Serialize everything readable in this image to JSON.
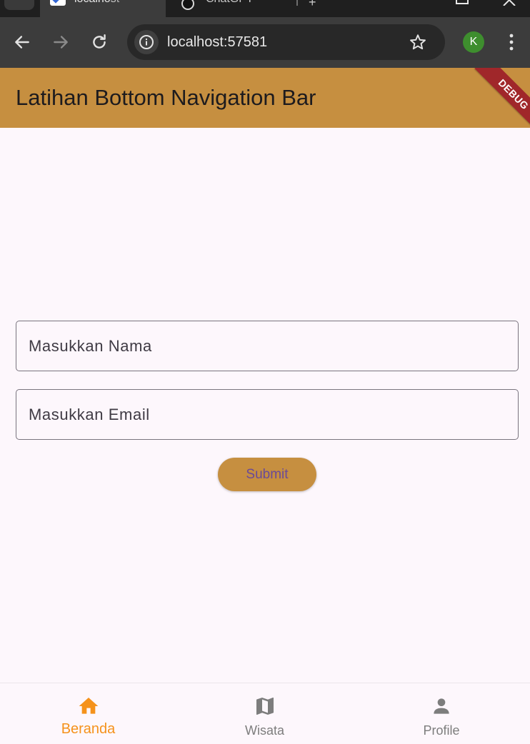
{
  "browser": {
    "tabs": [
      {
        "title": "localhost",
        "active": true
      },
      {
        "title": "ChatGPT",
        "active": false
      }
    ],
    "url": "localhost:57581",
    "profile_initial": "K"
  },
  "app": {
    "title": "Latihan Bottom Navigation Bar",
    "debug_banner": "DEBUG",
    "colors": {
      "primary": "#c68f40",
      "background": "#fdf7fc",
      "nav_active": "#f5921b",
      "nav_inactive": "#7d7d7d",
      "debug_banner": "#a0272a"
    }
  },
  "form": {
    "name_field": {
      "placeholder": "Masukkan Nama",
      "value": ""
    },
    "email_field": {
      "placeholder": "Masukkan Email",
      "value": ""
    },
    "submit_label": "Submit"
  },
  "bottom_nav": {
    "items": [
      {
        "label": "Beranda",
        "icon": "home-icon",
        "active": true
      },
      {
        "label": "Wisata",
        "icon": "map-icon",
        "active": false
      },
      {
        "label": "Profile",
        "icon": "person-icon",
        "active": false
      }
    ]
  }
}
